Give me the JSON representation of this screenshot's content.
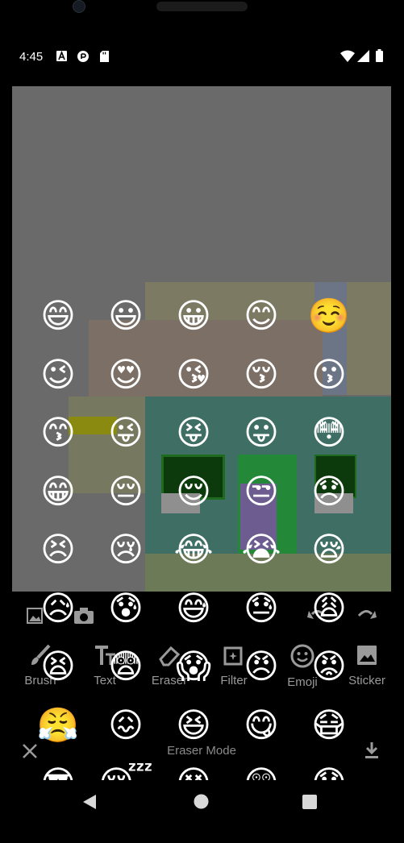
{
  "status_bar": {
    "time": "4:45",
    "left_icons": [
      "font-a-icon",
      "play-protect-icon",
      "sd-card-icon"
    ],
    "right_icons": [
      "wifi-icon",
      "signal-icon",
      "battery-icon"
    ]
  },
  "toolbar": {
    "top_icons": [
      "gallery-icon",
      "camera-icon",
      "undo-icon",
      "redo-icon"
    ],
    "tools": [
      {
        "label": "Brush",
        "icon": "brush-icon"
      },
      {
        "label": "Text",
        "icon": "text-icon"
      },
      {
        "label": "Eraser",
        "icon": "eraser-icon"
      },
      {
        "label": "Filter",
        "icon": "filter-icon"
      },
      {
        "label": "Emoji",
        "icon": "emoji-icon"
      },
      {
        "label": "Sticker",
        "icon": "sticker-icon"
      }
    ],
    "mode_label": "Eraser Mode",
    "close_icon": "close-icon",
    "download_icon": "download-icon"
  },
  "emoji_picker": {
    "emojis": [
      "😄",
      "😃",
      "😀",
      "😊",
      "☺️",
      "😉",
      "😍",
      "😘",
      "😚",
      "😗",
      "😙",
      "😜",
      "😝",
      "😛",
      "😳",
      "😁",
      "😔",
      "😌",
      "😒",
      "😞",
      "😣",
      "😢",
      "😂",
      "😭",
      "😪",
      "😥",
      "😰",
      "😅",
      "😓",
      "😩",
      "😫",
      "😨",
      "😱",
      "😠",
      "😡",
      "😤",
      "😖",
      "😆",
      "😋",
      "😷",
      "😎",
      "😴",
      "😵",
      "😲",
      "😟"
    ]
  },
  "nav_bar": {
    "icons": [
      "back-icon",
      "home-icon",
      "recents-icon"
    ]
  }
}
